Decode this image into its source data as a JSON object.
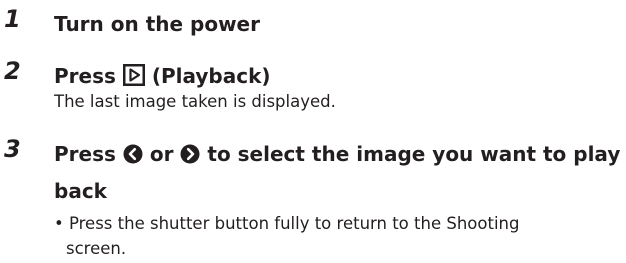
{
  "steps": [
    {
      "number": "1",
      "title": "Turn on the power"
    },
    {
      "number": "2",
      "title_prefix": "Press",
      "title_icon": "playback-button-icon",
      "title_suffix": "(Playback)",
      "description": "The last image taken is displayed."
    },
    {
      "number": "3",
      "title_part1": "Press",
      "title_icon_left": "left-arrow-button-icon",
      "title_part2": "or",
      "title_icon_right": "right-arrow-button-icon",
      "title_part3": "to select the image you want to play",
      "title_line2": "back",
      "bullet": "• Press the shutter button fully to return to the Shooting",
      "bullet_cont": "screen."
    }
  ]
}
